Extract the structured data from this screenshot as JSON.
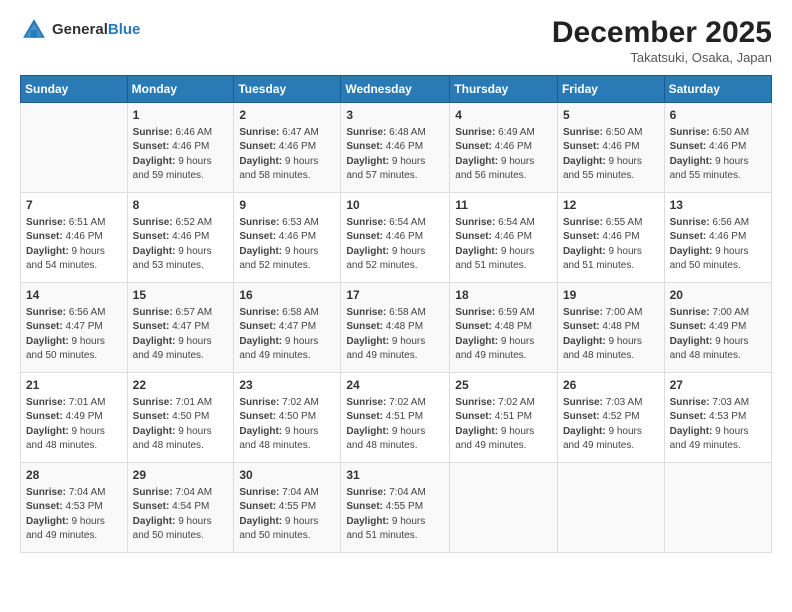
{
  "header": {
    "logo_general": "General",
    "logo_blue": "Blue",
    "month_title": "December 2025",
    "location": "Takatsuki, Osaka, Japan"
  },
  "weekdays": [
    "Sunday",
    "Monday",
    "Tuesday",
    "Wednesday",
    "Thursday",
    "Friday",
    "Saturday"
  ],
  "weeks": [
    [
      {
        "day": "",
        "info": ""
      },
      {
        "day": "1",
        "info": "Sunrise: 6:46 AM\nSunset: 4:46 PM\nDaylight: 9 hours\nand 59 minutes."
      },
      {
        "day": "2",
        "info": "Sunrise: 6:47 AM\nSunset: 4:46 PM\nDaylight: 9 hours\nand 58 minutes."
      },
      {
        "day": "3",
        "info": "Sunrise: 6:48 AM\nSunset: 4:46 PM\nDaylight: 9 hours\nand 57 minutes."
      },
      {
        "day": "4",
        "info": "Sunrise: 6:49 AM\nSunset: 4:46 PM\nDaylight: 9 hours\nand 56 minutes."
      },
      {
        "day": "5",
        "info": "Sunrise: 6:50 AM\nSunset: 4:46 PM\nDaylight: 9 hours\nand 55 minutes."
      },
      {
        "day": "6",
        "info": "Sunrise: 6:50 AM\nSunset: 4:46 PM\nDaylight: 9 hours\nand 55 minutes."
      }
    ],
    [
      {
        "day": "7",
        "info": "Sunrise: 6:51 AM\nSunset: 4:46 PM\nDaylight: 9 hours\nand 54 minutes."
      },
      {
        "day": "8",
        "info": "Sunrise: 6:52 AM\nSunset: 4:46 PM\nDaylight: 9 hours\nand 53 minutes."
      },
      {
        "day": "9",
        "info": "Sunrise: 6:53 AM\nSunset: 4:46 PM\nDaylight: 9 hours\nand 52 minutes."
      },
      {
        "day": "10",
        "info": "Sunrise: 6:54 AM\nSunset: 4:46 PM\nDaylight: 9 hours\nand 52 minutes."
      },
      {
        "day": "11",
        "info": "Sunrise: 6:54 AM\nSunset: 4:46 PM\nDaylight: 9 hours\nand 51 minutes."
      },
      {
        "day": "12",
        "info": "Sunrise: 6:55 AM\nSunset: 4:46 PM\nDaylight: 9 hours\nand 51 minutes."
      },
      {
        "day": "13",
        "info": "Sunrise: 6:56 AM\nSunset: 4:46 PM\nDaylight: 9 hours\nand 50 minutes."
      }
    ],
    [
      {
        "day": "14",
        "info": "Sunrise: 6:56 AM\nSunset: 4:47 PM\nDaylight: 9 hours\nand 50 minutes."
      },
      {
        "day": "15",
        "info": "Sunrise: 6:57 AM\nSunset: 4:47 PM\nDaylight: 9 hours\nand 49 minutes."
      },
      {
        "day": "16",
        "info": "Sunrise: 6:58 AM\nSunset: 4:47 PM\nDaylight: 9 hours\nand 49 minutes."
      },
      {
        "day": "17",
        "info": "Sunrise: 6:58 AM\nSunset: 4:48 PM\nDaylight: 9 hours\nand 49 minutes."
      },
      {
        "day": "18",
        "info": "Sunrise: 6:59 AM\nSunset: 4:48 PM\nDaylight: 9 hours\nand 49 minutes."
      },
      {
        "day": "19",
        "info": "Sunrise: 7:00 AM\nSunset: 4:48 PM\nDaylight: 9 hours\nand 48 minutes."
      },
      {
        "day": "20",
        "info": "Sunrise: 7:00 AM\nSunset: 4:49 PM\nDaylight: 9 hours\nand 48 minutes."
      }
    ],
    [
      {
        "day": "21",
        "info": "Sunrise: 7:01 AM\nSunset: 4:49 PM\nDaylight: 9 hours\nand 48 minutes."
      },
      {
        "day": "22",
        "info": "Sunrise: 7:01 AM\nSunset: 4:50 PM\nDaylight: 9 hours\nand 48 minutes."
      },
      {
        "day": "23",
        "info": "Sunrise: 7:02 AM\nSunset: 4:50 PM\nDaylight: 9 hours\nand 48 minutes."
      },
      {
        "day": "24",
        "info": "Sunrise: 7:02 AM\nSunset: 4:51 PM\nDaylight: 9 hours\nand 48 minutes."
      },
      {
        "day": "25",
        "info": "Sunrise: 7:02 AM\nSunset: 4:51 PM\nDaylight: 9 hours\nand 49 minutes."
      },
      {
        "day": "26",
        "info": "Sunrise: 7:03 AM\nSunset: 4:52 PM\nDaylight: 9 hours\nand 49 minutes."
      },
      {
        "day": "27",
        "info": "Sunrise: 7:03 AM\nSunset: 4:53 PM\nDaylight: 9 hours\nand 49 minutes."
      }
    ],
    [
      {
        "day": "28",
        "info": "Sunrise: 7:04 AM\nSunset: 4:53 PM\nDaylight: 9 hours\nand 49 minutes."
      },
      {
        "day": "29",
        "info": "Sunrise: 7:04 AM\nSunset: 4:54 PM\nDaylight: 9 hours\nand 50 minutes."
      },
      {
        "day": "30",
        "info": "Sunrise: 7:04 AM\nSunset: 4:55 PM\nDaylight: 9 hours\nand 50 minutes."
      },
      {
        "day": "31",
        "info": "Sunrise: 7:04 AM\nSunset: 4:55 PM\nDaylight: 9 hours\nand 51 minutes."
      },
      {
        "day": "",
        "info": ""
      },
      {
        "day": "",
        "info": ""
      },
      {
        "day": "",
        "info": ""
      }
    ]
  ]
}
